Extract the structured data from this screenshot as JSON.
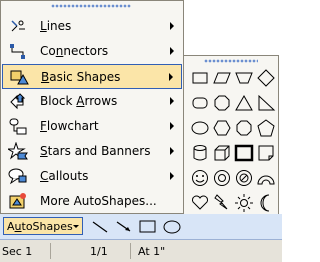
{
  "menu": {
    "items": [
      {
        "label": "Lines",
        "underline": "L",
        "rest": "ines",
        "icon": "lines-icon"
      },
      {
        "label": "Connectors",
        "underline": "n",
        "prefix": "Co",
        "rest": "nectors",
        "icon": "connectors-icon"
      },
      {
        "label": "Basic Shapes",
        "underline": "B",
        "rest": "asic Shapes",
        "icon": "basic-shapes-icon"
      },
      {
        "label": "Block Arrows",
        "underline": "A",
        "prefix": "Block ",
        "rest": "rrows",
        "icon": "block-arrows-icon"
      },
      {
        "label": "Flowchart",
        "underline": "F",
        "rest": "lowchart",
        "icon": "flowchart-icon"
      },
      {
        "label": "Stars and Banners",
        "underline": "S",
        "rest": "tars and Banners",
        "icon": "stars-icon"
      },
      {
        "label": "Callouts",
        "underline": "C",
        "rest": "allouts",
        "icon": "callouts-icon"
      },
      {
        "label": "More AutoShapes...",
        "underline": "",
        "rest": "More AutoShapes...",
        "icon": "more-autoshapes-icon"
      }
    ]
  },
  "toolbar": {
    "autoshapes_label": "AutoShapes",
    "autoshapes_underline": "u"
  },
  "status": {
    "section": "Sec 1",
    "pages": "1/1",
    "at": "At 1\""
  },
  "colors": {
    "highlight": "#fbe5a8",
    "highlight_border": "#315fb5",
    "menu_bg": "#f7f6f2",
    "toolbar_bg": "#d8e5f7"
  }
}
